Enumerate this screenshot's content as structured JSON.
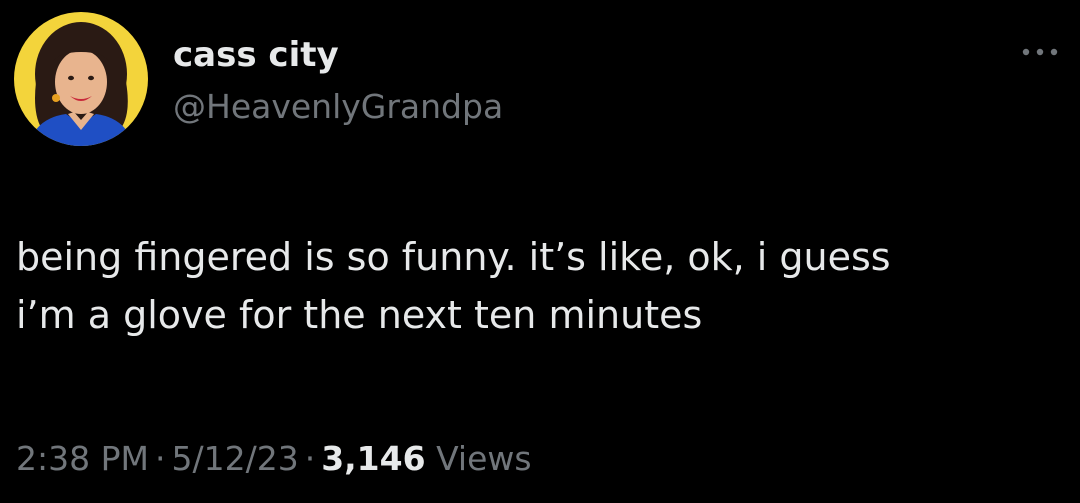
{
  "tweet": {
    "display_name": "cass city",
    "handle": "@HeavenlyGrandpa",
    "text_line1": "being fingered is so funny. it’s like, ok, i guess",
    "text_line2": "i’m a glove for the next ten minutes",
    "time": "2:38 PM",
    "separator": "·",
    "date": "5/12/23",
    "views_count": "3,146",
    "views_label": "Views"
  },
  "icons": {
    "avatar": "profile-photo",
    "more": "more-options-icon"
  },
  "colors": {
    "background": "#000000",
    "primary_text": "#e7e9ea",
    "secondary_text": "#71767b",
    "avatar_bg": "#f3d43b"
  }
}
